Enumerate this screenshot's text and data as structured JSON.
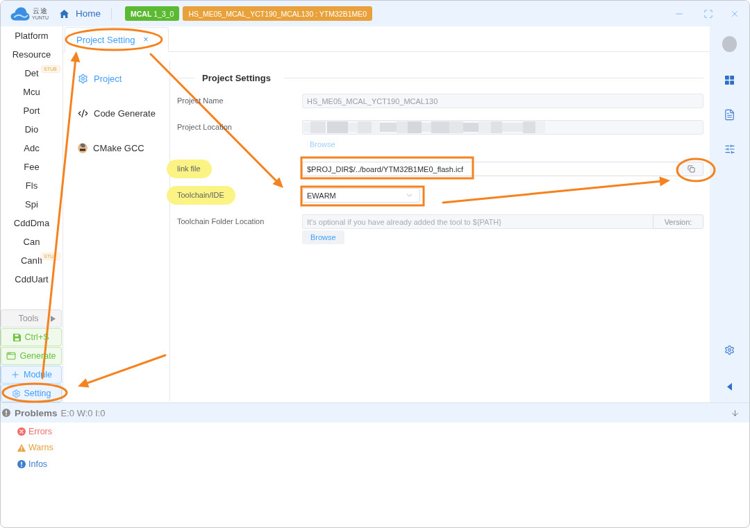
{
  "window": {
    "logo": {
      "name": "云途",
      "tagline": "YUNTU"
    },
    "home": "Home",
    "badges": [
      {
        "text": "**MCAL** 1_3_0",
        "color": "#5bb932"
      },
      {
        "text": "HS_ME05_MCAL_YCT190_MCAL130 : YTM32B1ME0",
        "color": "#e9a23b"
      }
    ]
  },
  "sidebar": {
    "modules": [
      {
        "label": "Platform"
      },
      {
        "label": "Resource"
      },
      {
        "label": "Det",
        "tag": "STUB"
      },
      {
        "label": "Mcu"
      },
      {
        "label": "Port"
      },
      {
        "label": "Dio"
      },
      {
        "label": "Adc"
      },
      {
        "label": "Fee"
      },
      {
        "label": "Fls"
      },
      {
        "label": "Spi"
      },
      {
        "label": "CddDma"
      },
      {
        "label": "Can"
      },
      {
        "label": "CanIf",
        "tag": "STU"
      },
      {
        "label": "CddUart"
      }
    ],
    "tools": [
      {
        "kind": "menu",
        "label": "Tools"
      },
      {
        "kind": "save",
        "label": "Ctrl+S"
      },
      {
        "kind": "generate",
        "label": "Generate"
      },
      {
        "kind": "add",
        "label": "Module"
      },
      {
        "kind": "setting",
        "label": "Setting"
      }
    ]
  },
  "tabs": [
    {
      "label": "Project Setting",
      "close": "×",
      "selected": true
    }
  ],
  "settings_nav": [
    {
      "kind": "general",
      "label": "Project",
      "selected": true
    },
    {
      "kind": "code",
      "label": "Code Generate",
      "selected": false
    },
    {
      "kind": "cmake",
      "label": "CMake GCC",
      "selected": false
    }
  ],
  "form": {
    "title": "Project Settings",
    "fields": [
      {
        "kind": "text",
        "label": "Project Name",
        "value": "HS_ME05_MCAL_YCT190_MCAL130",
        "disabled": true,
        "highlighted": false
      },
      {
        "kind": "blurred",
        "label": "Project Location",
        "disabled": true,
        "highlighted": false,
        "action": {
          "kind": "link",
          "label": "Browse",
          "disabled": true
        }
      },
      {
        "kind": "copy",
        "label": "link file",
        "value": "$PROJ_DIR$/../board/YTM32B1ME0_flash.icf",
        "disabled": false,
        "highlighted": true
      },
      {
        "kind": "select",
        "label": "Toolchain/IDE",
        "value": "EWARM",
        "disabled": false,
        "highlighted": true
      },
      {
        "kind": "addon",
        "label": "Toolchain Folder Location",
        "placeholder": "It's optional if you have already added the tool to ${PATH}",
        "addon": "Version:",
        "disabled": true,
        "highlighted": false,
        "action": {
          "kind": "button",
          "label": "Browse",
          "disabled": false
        }
      }
    ]
  },
  "problems": {
    "title": "Problems",
    "summary": "E:0 W:0 I:0",
    "items": [
      {
        "kind": "error",
        "label": "Errors"
      },
      {
        "kind": "warning",
        "label": "Warns"
      },
      {
        "kind": "info",
        "label": "Infos"
      }
    ]
  }
}
